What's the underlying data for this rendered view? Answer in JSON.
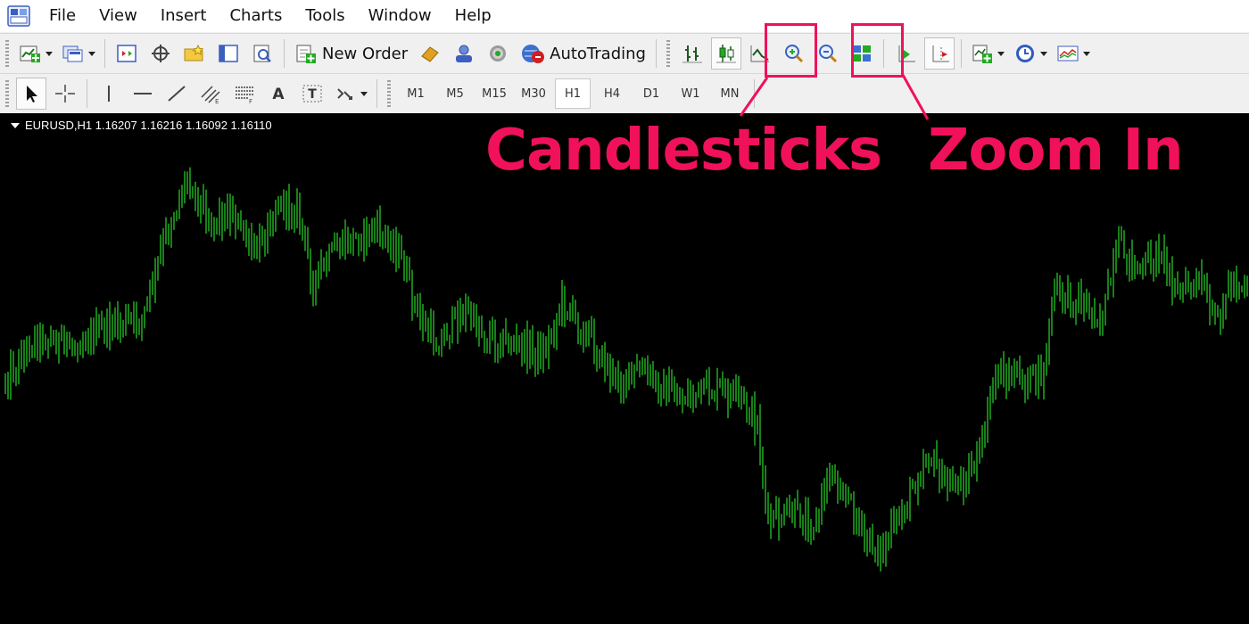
{
  "menu": {
    "items": [
      "File",
      "View",
      "Insert",
      "Charts",
      "Tools",
      "Window",
      "Help"
    ]
  },
  "toolbar": {
    "new_order_label": "New Order",
    "autotrading_label": "AutoTrading"
  },
  "timeframes": [
    "M1",
    "M5",
    "M15",
    "M30",
    "H1",
    "H4",
    "D1",
    "W1",
    "MN"
  ],
  "active_timeframe": "H1",
  "chart": {
    "header": "EURUSD,H1  1.16207 1.16216 1.16092 1.16110",
    "line_color": "#1fa01f",
    "background_color": "#000000"
  },
  "annotations": {
    "candlesticks_label": "Candlesticks",
    "zoom_in_label": "Zoom In",
    "color": "#f0115a"
  },
  "icons": {
    "text_tool": "A",
    "text_label_tool": "T"
  }
}
